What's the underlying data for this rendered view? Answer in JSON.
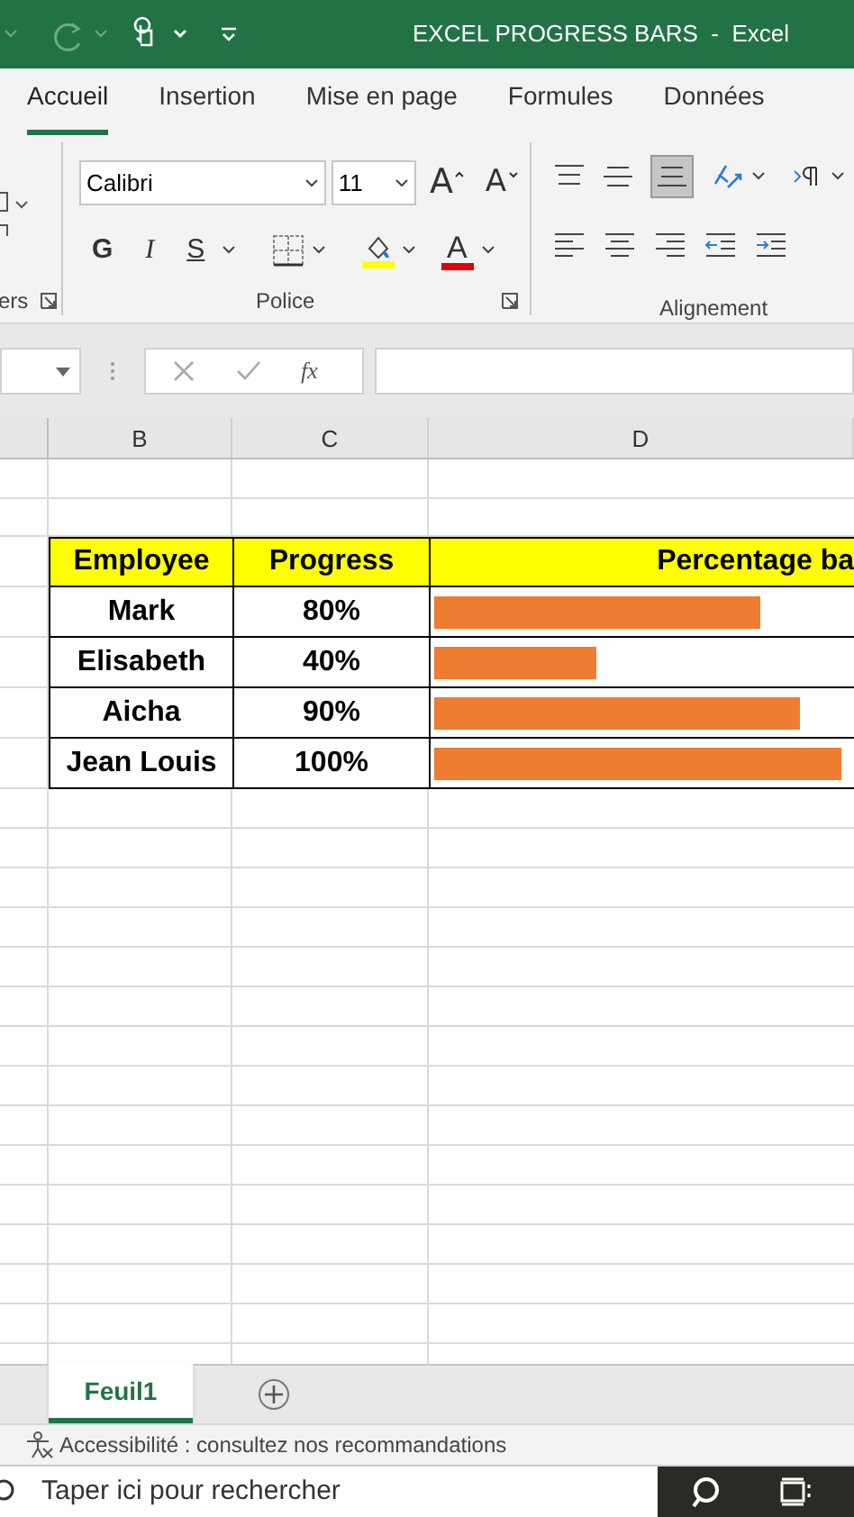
{
  "window": {
    "title": "EXCEL PROGRESS BARS  -  Excel"
  },
  "tabs": [
    {
      "label": "Accueil",
      "selected": true
    },
    {
      "label": "Insertion",
      "selected": false
    },
    {
      "label": "Mise en page",
      "selected": false
    },
    {
      "label": "Formules",
      "selected": false
    },
    {
      "label": "Données",
      "selected": false
    }
  ],
  "ribbon": {
    "font_name": "Calibri",
    "font_size": "11",
    "bold": "G",
    "italic": "I",
    "underline": "S",
    "grow": "A",
    "shrink": "A",
    "font_color": "A",
    "groups": [
      "ers",
      "Police",
      "Alignement"
    ]
  },
  "formula_bar": {
    "fx": "fx"
  },
  "columns": [
    "B",
    "C",
    "D"
  ],
  "table": {
    "headers": [
      "Employee",
      "Progress",
      "Percentage ba"
    ],
    "rows": [
      {
        "name": "Mark",
        "progress": "80%",
        "level": 0.8
      },
      {
        "name": "Elisabeth",
        "progress": "40%",
        "level": 0.4
      },
      {
        "name": "Aicha",
        "progress": "90%",
        "level": 0.9
      },
      {
        "name": "Jean Louis",
        "progress": "100%",
        "level": 1.0
      }
    ]
  },
  "sheets": [
    {
      "label": "Feuil1",
      "selected": true
    }
  ],
  "status_bar": {
    "text": "Accessibilité : consultez nos recommandations"
  },
  "taskbar": {
    "search": {
      "placeholder": "Taper ici pour rechercher"
    }
  }
}
